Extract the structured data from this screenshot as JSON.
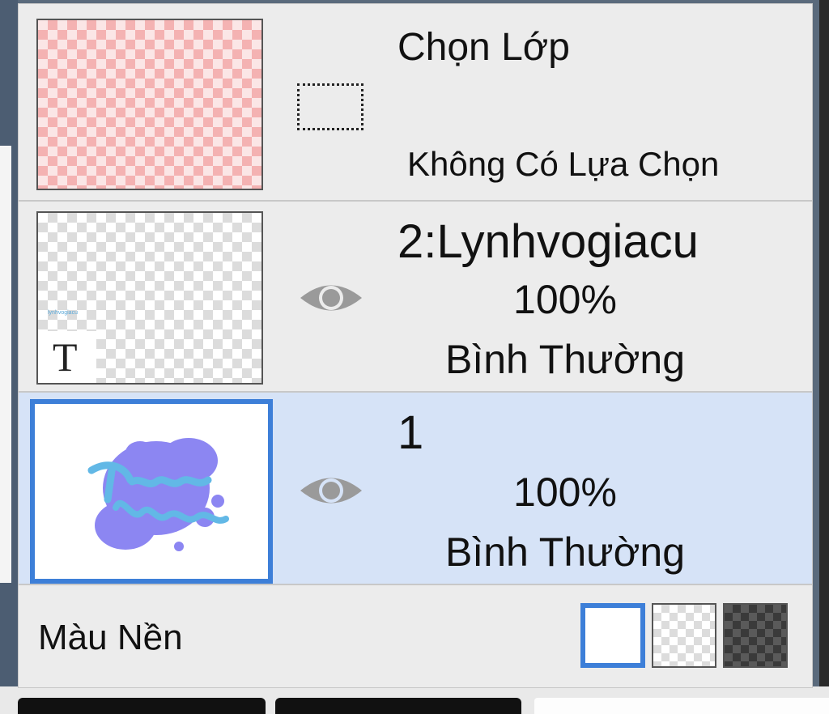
{
  "selection_layer": {
    "title": "Chọn Lớp",
    "status": "Không Có Lựa Chọn"
  },
  "layers": [
    {
      "name": "2:Lynhvogiacu",
      "opacity": "100%",
      "blend_mode": "Bình Thường",
      "visible": true,
      "selected": false,
      "type_badge": "T",
      "thumb_text": "lynhvogiacu"
    },
    {
      "name": "1",
      "opacity": "100%",
      "blend_mode": "Bình Thường",
      "visible": true,
      "selected": true
    }
  ],
  "background": {
    "label": "Màu Nền",
    "options": [
      "white",
      "checker-light",
      "checker-dark"
    ],
    "selected": "white"
  },
  "colors": {
    "selection_blue": "#3d7fd8",
    "selected_row": "#d6e3f7",
    "panel_bg": "#ececec",
    "eye_gray": "#9a9a9a"
  }
}
